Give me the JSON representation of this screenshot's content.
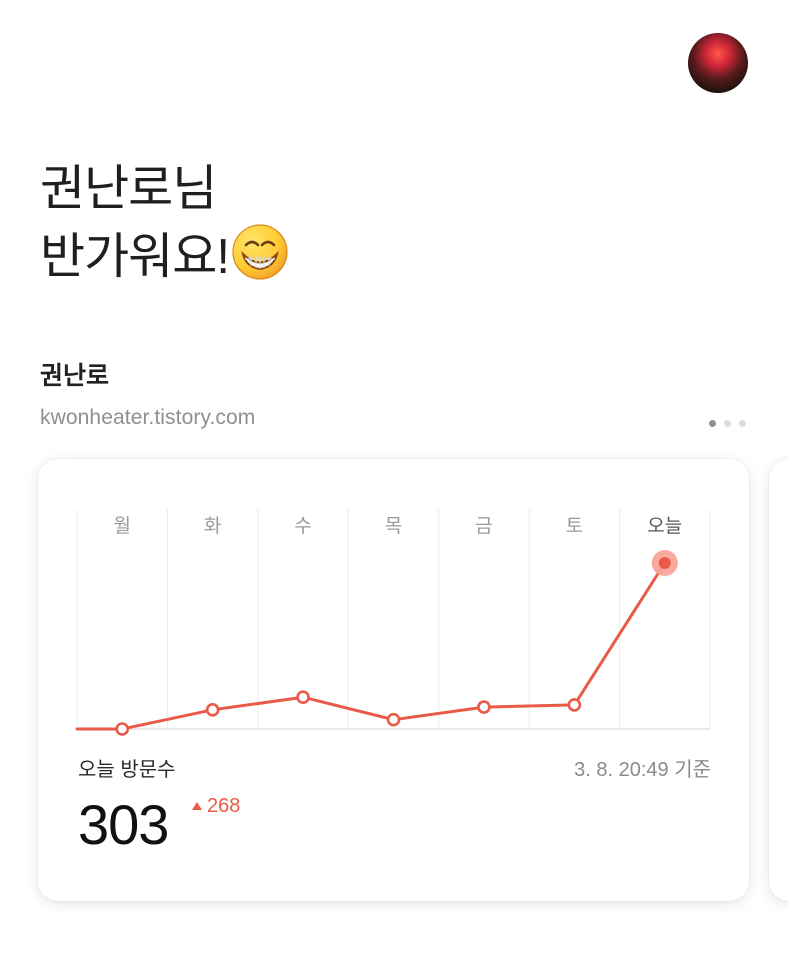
{
  "header": {
    "greeting_line1": "권난로님",
    "greeting_line2": "반가워요!"
  },
  "blog": {
    "name": "권난로",
    "url": "kwonheater.tistory.com"
  },
  "pager": {
    "total": 3,
    "current": 1
  },
  "stats": {
    "visits_label": "오늘 방문수",
    "timestamp": "3. 8. 20:49 기준",
    "visits_today": "303",
    "delta": "268"
  },
  "chart_data": {
    "type": "line",
    "categories": [
      "월",
      "화",
      "수",
      "목",
      "금",
      "토",
      "오늘"
    ],
    "values": [
      0,
      35,
      58,
      17,
      40,
      44,
      303
    ],
    "ylim": [
      0,
      303
    ],
    "grid": true,
    "highlight_last": true
  },
  "colors": {
    "accent": "#ea5a48",
    "accent_light": "#f7a096",
    "text_primary": "#1f1f1f",
    "text_secondary": "#8f8f8f",
    "grid": "#ececec"
  },
  "icons": {
    "emoji": "grinning-face-icon",
    "avatar": "profile-image"
  }
}
